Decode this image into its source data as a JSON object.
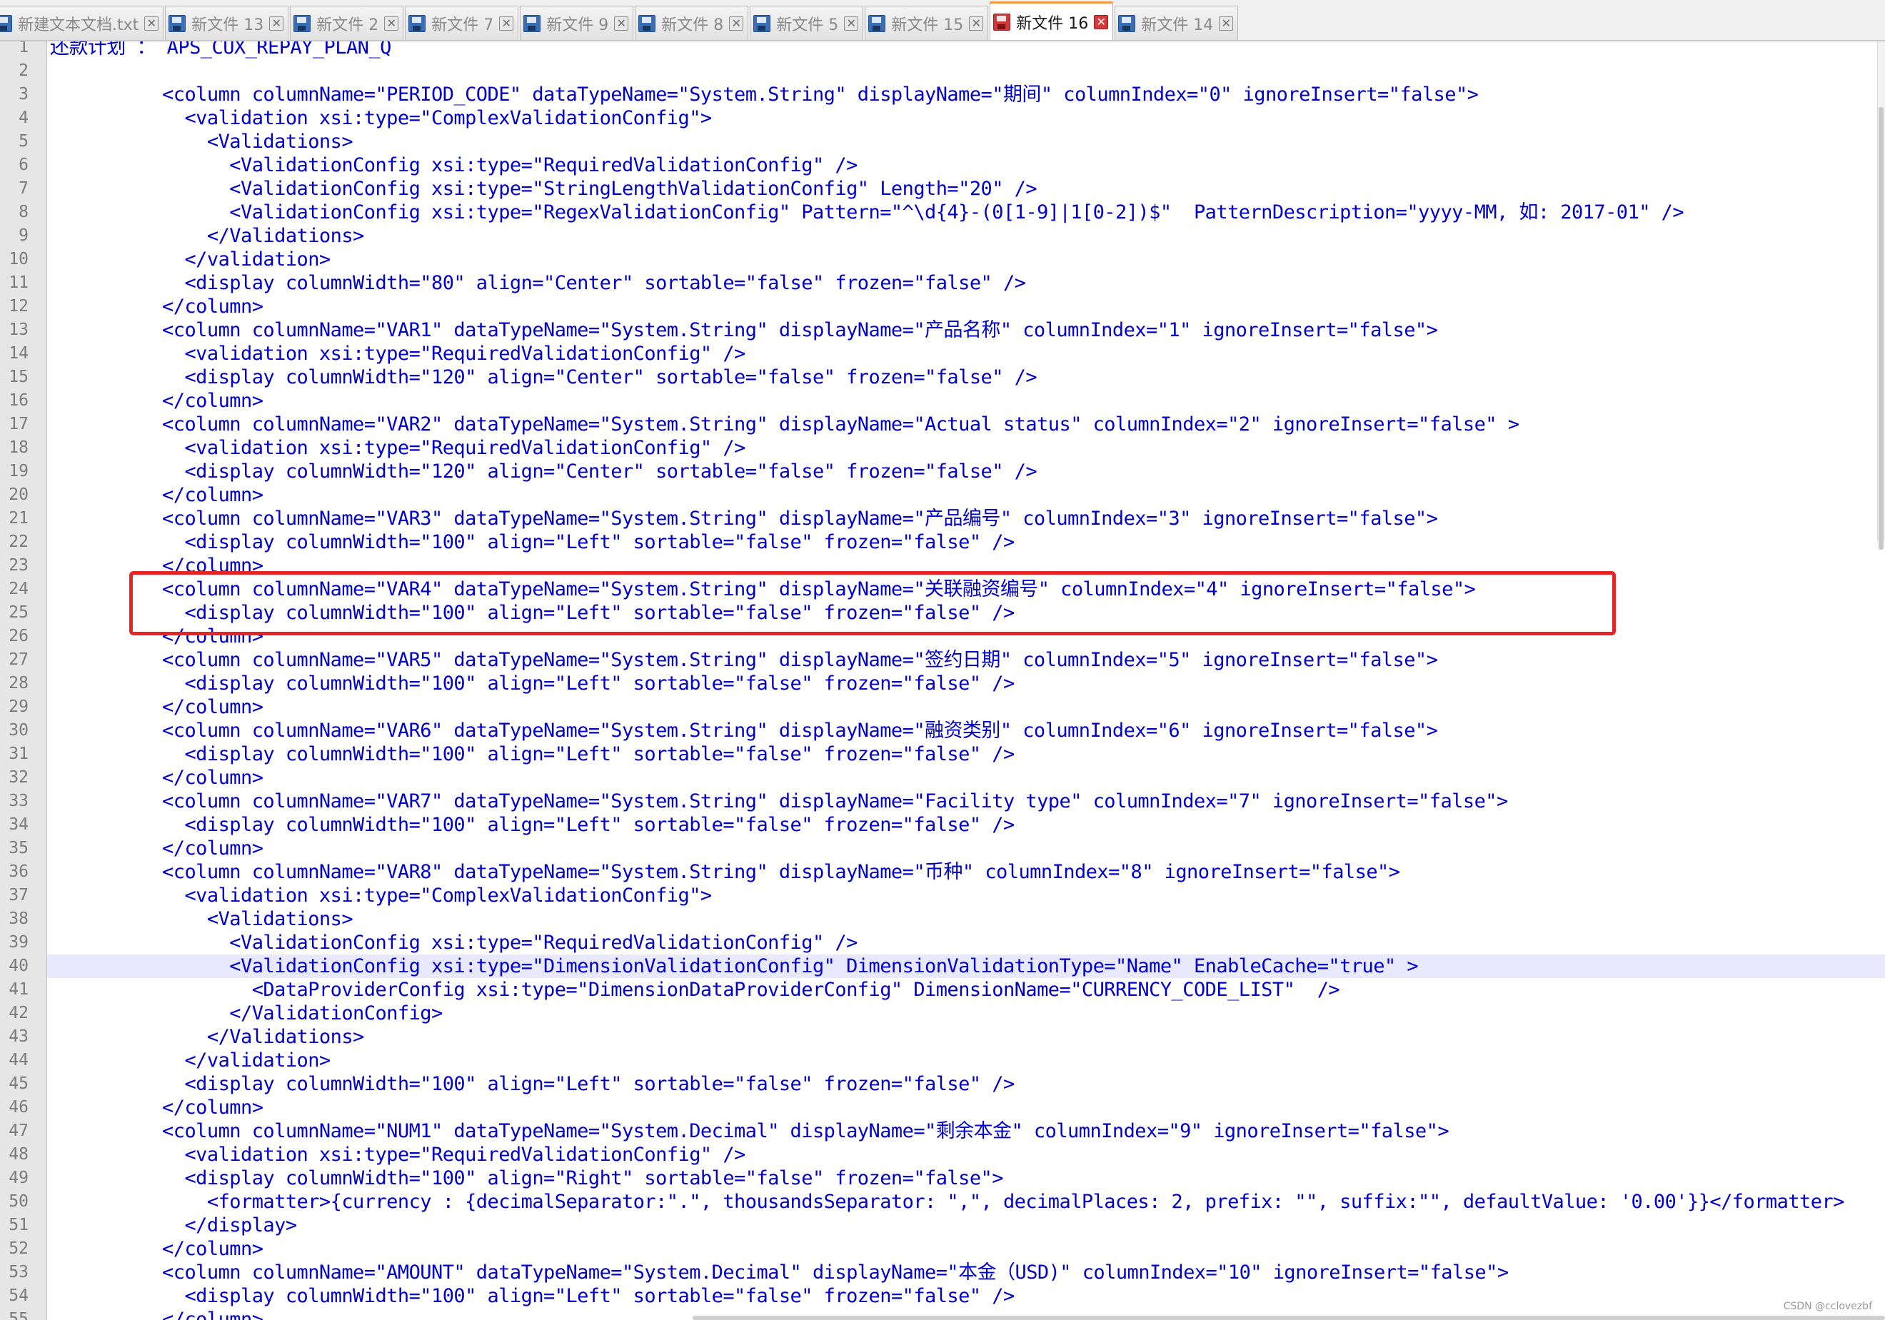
{
  "tabs": [
    {
      "label": "新建文本文档.txt",
      "active": false,
      "x": -12
    },
    {
      "label": "新文件 13",
      "active": false
    },
    {
      "label": "新文件 2",
      "active": false
    },
    {
      "label": "新文件 7",
      "active": false
    },
    {
      "label": "新文件 9",
      "active": false
    },
    {
      "label": "新文件 8",
      "active": false
    },
    {
      "label": "新文件 5",
      "active": false
    },
    {
      "label": "新文件 15",
      "active": false
    },
    {
      "label": "新文件 16",
      "active": true
    },
    {
      "label": "新文件 14",
      "active": false
    }
  ],
  "tab_close_glyph": "✕",
  "current_line": 40,
  "lines": [
    "还款计划 ： APS_CUX_REPAY_PLAN_Q",
    "",
    "          <column columnName=\"PERIOD_CODE\" dataTypeName=\"System.String\" displayName=\"期间\" columnIndex=\"0\" ignoreInsert=\"false\">",
    "            <validation xsi:type=\"ComplexValidationConfig\">",
    "              <Validations>",
    "                <ValidationConfig xsi:type=\"RequiredValidationConfig\" />",
    "                <ValidationConfig xsi:type=\"StringLengthValidationConfig\" Length=\"20\" />",
    "                <ValidationConfig xsi:type=\"RegexValidationConfig\" Pattern=\"^\\d{4}-(0[1-9]|1[0-2])$\"  PatternDescription=\"yyyy-MM, 如: 2017-01\" />",
    "              </Validations>",
    "            </validation>",
    "            <display columnWidth=\"80\" align=\"Center\" sortable=\"false\" frozen=\"false\" />",
    "          </column>",
    "          <column columnName=\"VAR1\" dataTypeName=\"System.String\" displayName=\"产品名称\" columnIndex=\"1\" ignoreInsert=\"false\">",
    "            <validation xsi:type=\"RequiredValidationConfig\" />",
    "            <display columnWidth=\"120\" align=\"Center\" sortable=\"false\" frozen=\"false\" />",
    "          </column>",
    "          <column columnName=\"VAR2\" dataTypeName=\"System.String\" displayName=\"Actual status\" columnIndex=\"2\" ignoreInsert=\"false\" >",
    "            <validation xsi:type=\"RequiredValidationConfig\" />",
    "            <display columnWidth=\"120\" align=\"Center\" sortable=\"false\" frozen=\"false\" />",
    "          </column>",
    "          <column columnName=\"VAR3\" dataTypeName=\"System.String\" displayName=\"产品编号\" columnIndex=\"3\" ignoreInsert=\"false\">",
    "            <display columnWidth=\"100\" align=\"Left\" sortable=\"false\" frozen=\"false\" />",
    "          </column>",
    "          <column columnName=\"VAR4\" dataTypeName=\"System.String\" displayName=\"关联融资编号\" columnIndex=\"4\" ignoreInsert=\"false\">",
    "            <display columnWidth=\"100\" align=\"Left\" sortable=\"false\" frozen=\"false\" />",
    "          </column>",
    "          <column columnName=\"VAR5\" dataTypeName=\"System.String\" displayName=\"签约日期\" columnIndex=\"5\" ignoreInsert=\"false\">",
    "            <display columnWidth=\"100\" align=\"Left\" sortable=\"false\" frozen=\"false\" />",
    "          </column>",
    "          <column columnName=\"VAR6\" dataTypeName=\"System.String\" displayName=\"融资类别\" columnIndex=\"6\" ignoreInsert=\"false\">",
    "            <display columnWidth=\"100\" align=\"Left\" sortable=\"false\" frozen=\"false\" />",
    "          </column>",
    "          <column columnName=\"VAR7\" dataTypeName=\"System.String\" displayName=\"Facility type\" columnIndex=\"7\" ignoreInsert=\"false\">",
    "            <display columnWidth=\"100\" align=\"Left\" sortable=\"false\" frozen=\"false\" />",
    "          </column>",
    "          <column columnName=\"VAR8\" dataTypeName=\"System.String\" displayName=\"币种\" columnIndex=\"8\" ignoreInsert=\"false\">",
    "            <validation xsi:type=\"ComplexValidationConfig\">",
    "              <Validations>",
    "                <ValidationConfig xsi:type=\"RequiredValidationConfig\" />",
    "                <ValidationConfig xsi:type=\"DimensionValidationConfig\" DimensionValidationType=\"Name\" EnableCache=\"true\" >",
    "                  <DataProviderConfig xsi:type=\"DimensionDataProviderConfig\" DimensionName=\"CURRENCY_CODE_LIST\"  />",
    "                </ValidationConfig>",
    "              </Validations>",
    "            </validation>",
    "            <display columnWidth=\"100\" align=\"Left\" sortable=\"false\" frozen=\"false\" />",
    "          </column>",
    "          <column columnName=\"NUM1\" dataTypeName=\"System.Decimal\" displayName=\"剩余本金\" columnIndex=\"9\" ignoreInsert=\"false\">",
    "            <validation xsi:type=\"RequiredValidationConfig\" />",
    "            <display columnWidth=\"100\" align=\"Right\" sortable=\"false\" frozen=\"false\">",
    "              <formatter>{currency : {decimalSeparator:\".\", thousandsSeparator: \",\", decimalPlaces: 2, prefix: \"\", suffix:\"\", defaultValue: '0.00'}}</formatter>",
    "            </display>",
    "          </column>",
    "          <column columnName=\"AMOUNT\" dataTypeName=\"System.Decimal\" displayName=\"本金（USD)\" columnIndex=\"10\" ignoreInsert=\"false\">",
    "            <display columnWidth=\"100\" align=\"Left\" sortable=\"false\" frozen=\"false\" />",
    "          </column>"
  ],
  "line_numbers": [
    "1",
    "2",
    "3",
    "4",
    "5",
    "6",
    "7",
    "8",
    "9",
    "10",
    "11",
    "12",
    "13",
    "14",
    "15",
    "16",
    "17",
    "18",
    "19",
    "20",
    "21",
    "22",
    "23",
    "24",
    "25",
    "26",
    "27",
    "28",
    "29",
    "30",
    "31",
    "32",
    "33",
    "34",
    "35",
    "36",
    "37",
    "38",
    "39",
    "40",
    "41",
    "42",
    "43",
    "44",
    "45",
    "46",
    "47",
    "48",
    "49",
    "50",
    "51",
    "52",
    "53",
    "54",
    "55"
  ],
  "watermark": "CSDN @cclovezbf"
}
